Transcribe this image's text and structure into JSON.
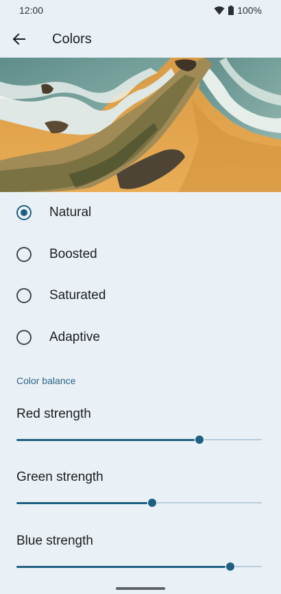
{
  "status_bar": {
    "time": "12:00",
    "battery": "100%"
  },
  "app_bar": {
    "title": "Colors"
  },
  "hero": {
    "image": "aerial-beach-coast"
  },
  "color_modes": [
    {
      "label": "Natural",
      "selected": true
    },
    {
      "label": "Boosted",
      "selected": false
    },
    {
      "label": "Saturated",
      "selected": false
    },
    {
      "label": "Adaptive",
      "selected": false
    }
  ],
  "color_balance": {
    "header": "Color balance",
    "sliders": [
      {
        "label": "Red strength",
        "value": 0.745
      },
      {
        "label": "Green strength",
        "value": 0.553
      },
      {
        "label": "Blue strength",
        "value": 0.872
      }
    ]
  },
  "colors": {
    "accent": "#1e5f82",
    "background": "#eaf1f6",
    "track_inactive": "#b6ccdc"
  }
}
